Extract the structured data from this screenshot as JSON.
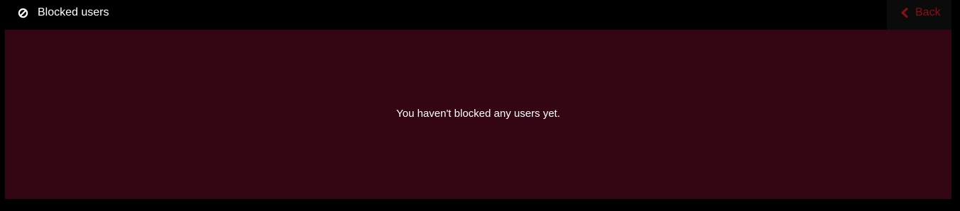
{
  "header": {
    "title": "Blocked users",
    "title_icon": "block-icon",
    "back": {
      "label": "Back",
      "icon": "chevron-left-icon"
    }
  },
  "main": {
    "empty_message": "You haven't blocked any users yet."
  },
  "colors": {
    "page_background": "#000000",
    "panel_background": "#340513",
    "back_button_background": "#0b0b0b",
    "accent_red": "#8b0f18",
    "text": "#ffffff"
  }
}
